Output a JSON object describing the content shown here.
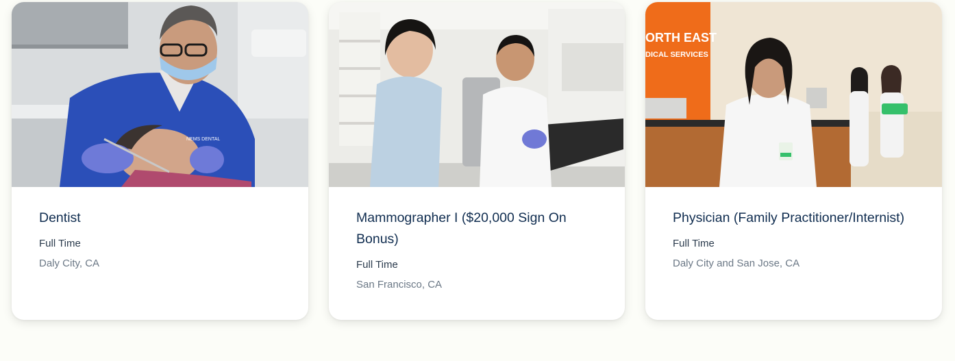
{
  "jobs": [
    {
      "title": "Dentist",
      "type": "Full Time",
      "location": "Daly City, CA",
      "photo_icon": "dentist-photo"
    },
    {
      "title": "Mammographer I ($20,000 Sign On Bonus)",
      "type": "Full Time",
      "location": "San Francisco, CA",
      "photo_icon": "mammography-photo"
    },
    {
      "title": "Physician (Family Practitioner/Internist)",
      "type": "Full Time",
      "location": "Daly City and San Jose, CA",
      "photo_icon": "physician-photo"
    }
  ],
  "signage": {
    "line1": "ORTH EAST",
    "line2": "DICAL SERVICES"
  },
  "badge": {
    "text": "NEMS DENTAL"
  },
  "colors": {
    "title": "#0f2c4f",
    "type": "#2a3a4c",
    "location": "#6a7785",
    "page_bg": "#fcfdf8",
    "brand_orange": "#ef6c1a"
  }
}
